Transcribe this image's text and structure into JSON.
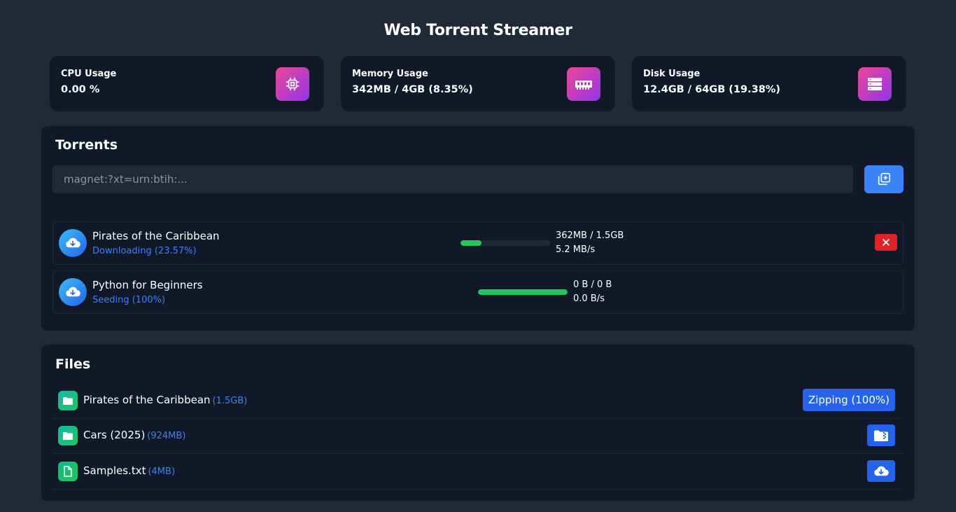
{
  "app": {
    "title": "Web Torrent Streamer"
  },
  "stats": [
    {
      "label": "CPU Usage",
      "value": "0.00 %",
      "icon": "cpu-icon"
    },
    {
      "label": "Memory Usage",
      "value": "342MB / 4GB (8.35%)",
      "icon": "memory-icon"
    },
    {
      "label": "Disk Usage",
      "value": "12.4GB / 64GB (19.38%)",
      "icon": "disk-icon"
    }
  ],
  "torrents": {
    "title": "Torrents",
    "input_placeholder": "magnet:?xt=urn:btih:...",
    "add_button_icon": "add-icon",
    "items": [
      {
        "name": "Pirates of the Caribbean",
        "status": "Downloading (23.57%)",
        "progress": 0.2357,
        "size": "362MB / 1.5GB",
        "speed": "5.2 MB/s",
        "removable": true
      },
      {
        "name": "Python for Beginners",
        "status": "Seeding (100%)",
        "progress": 1.0,
        "size": "0 B / 0 B",
        "speed": "0.0 B/s",
        "removable": false
      }
    ]
  },
  "files": {
    "title": "Files",
    "items": [
      {
        "name": "Pirates of the Caribbean",
        "size": "(1.5GB)",
        "type": "folder",
        "action": "Zipping (100%)"
      },
      {
        "name": "Cars (2025)",
        "size": "(924MB)",
        "type": "folder",
        "action_icon": "zip-folder-icon"
      },
      {
        "name": "Samples.txt",
        "size": "(4MB)",
        "type": "file",
        "action_icon": "cloud-download-icon"
      }
    ]
  },
  "colors": {
    "background": "#1f2937",
    "panel": "#111827",
    "accent": "#3b82f6",
    "progress": "#22c55e",
    "danger": "#dc2626"
  }
}
